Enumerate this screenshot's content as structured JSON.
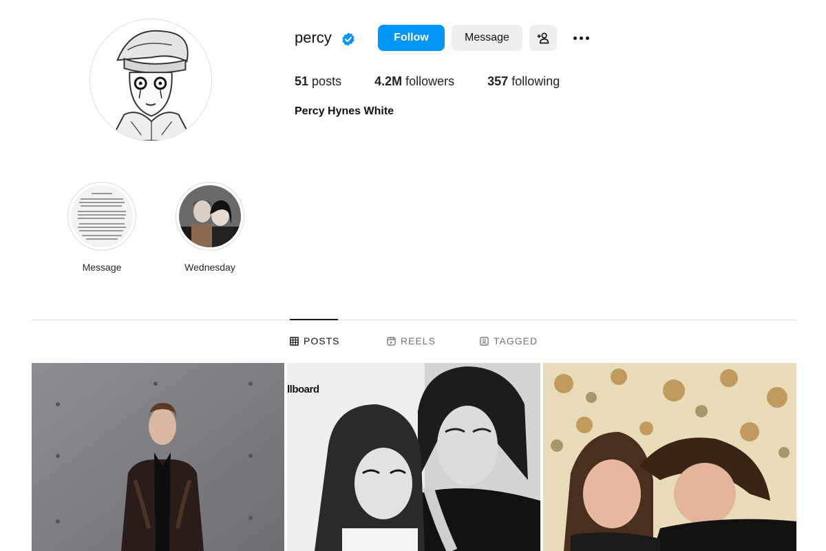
{
  "profile": {
    "username": "percy",
    "verified": true,
    "follow_label": "Follow",
    "message_label": "Message",
    "full_name": "Percy Hynes White",
    "stats": {
      "posts_count": "51",
      "posts_label": "posts",
      "followers_count": "4.2M",
      "followers_label": "followers",
      "following_count": "357",
      "following_label": "following"
    }
  },
  "highlights": [
    {
      "label": "Message"
    },
    {
      "label": "Wednesday"
    }
  ],
  "tabs": [
    {
      "label": "POSTS",
      "active": true,
      "icon": "grid-icon"
    },
    {
      "label": "REELS",
      "active": false,
      "icon": "reels-icon"
    },
    {
      "label": "TAGGED",
      "active": false,
      "icon": "tagged-icon"
    }
  ],
  "posts": [
    {
      "description_icon": "photo-man-sheer-shirt"
    },
    {
      "description_icon": "photo-black-and-white-couple",
      "watermark": "llboard"
    },
    {
      "description_icon": "photo-couple-floral-curtain"
    }
  ],
  "colors": {
    "accent": "#0095f6",
    "button_gray": "#efefef",
    "border": "#dbdbdb",
    "muted_text": "#737373"
  }
}
